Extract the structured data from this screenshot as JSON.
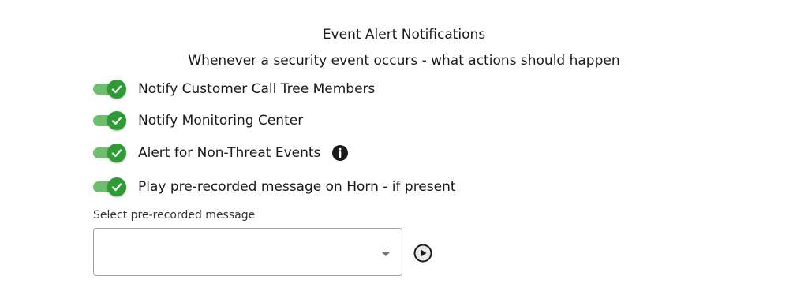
{
  "header": {
    "title": "Event Alert Notifications",
    "subtitle": "Whenever a security event occurs - what actions should happen"
  },
  "toggles": [
    {
      "label": "Notify Customer Call Tree Members",
      "checked": true
    },
    {
      "label": "Notify Monitoring Center",
      "checked": true
    },
    {
      "label": "Alert for Non-Threat Events",
      "checked": true,
      "info_icon": "info-icon"
    },
    {
      "label": "Play pre-recorded message on Horn - if present",
      "checked": true
    }
  ],
  "message_select": {
    "label": "Select pre-recorded message",
    "value": "",
    "arrow_icon": "caret-down-icon"
  },
  "play_icon": "play-circle-icon",
  "colors": {
    "toggle_track": "#6dbf6d",
    "toggle_knob": "#2e9b37",
    "check": "#ffffff",
    "text": "#1a1a1a"
  }
}
